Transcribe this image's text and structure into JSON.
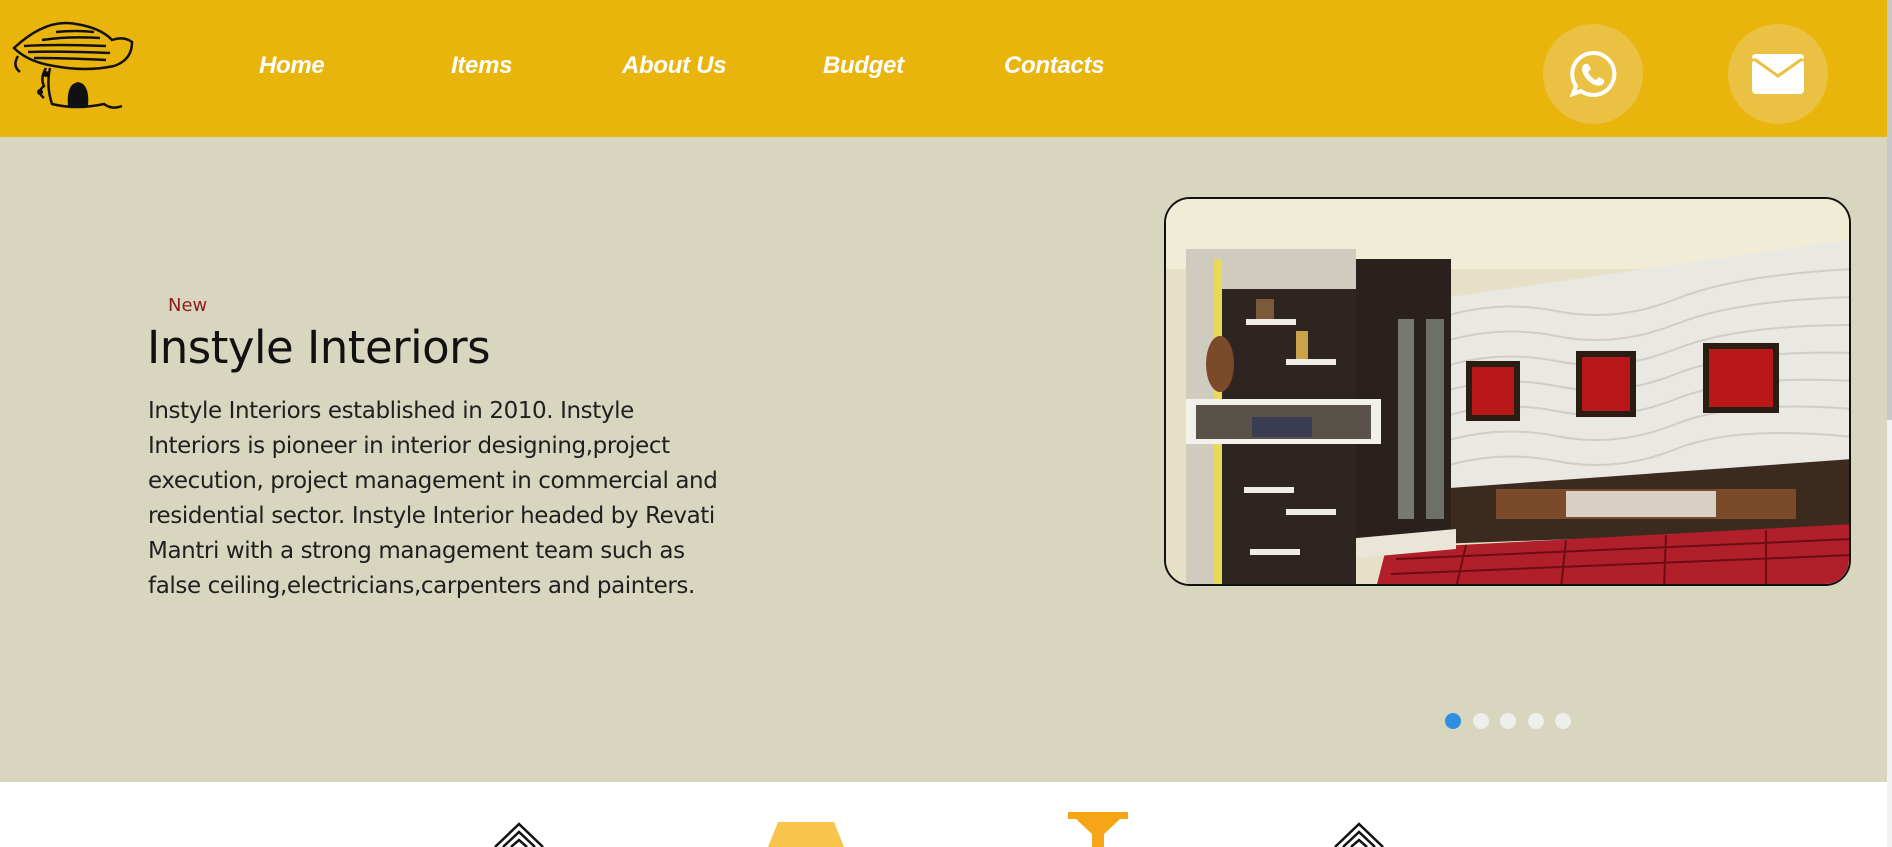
{
  "header": {
    "logo_icon": "cottage-hut-logo",
    "background": "#e9b40c",
    "nav": [
      {
        "label": "Home"
      },
      {
        "label": "Items"
      },
      {
        "label": "About Us"
      },
      {
        "label": "Budget"
      },
      {
        "label": "Contacts"
      }
    ],
    "whatsapp_icon": "whatsapp-icon",
    "email_icon": "envelope-icon"
  },
  "hero": {
    "background": "#d8d6bf",
    "tag": "New",
    "title": "Instyle Interiors",
    "description": "Instyle Interiors established in 2010. Instyle Interiors is pioneer in interior designing,project execution, project management in commercial and residential sector. Instyle Interior headed by Revati Mantri with a strong management team such as false ceiling,electricians,carpenters and painters.",
    "slide_image": "bedroom-interior-photo",
    "carousel": {
      "total": 5,
      "active": 1
    }
  },
  "features": {
    "icons": [
      "diamond-layers-icon",
      "lamp-shade-icon",
      "trophy-icon",
      "diamond-layers-icon"
    ]
  }
}
